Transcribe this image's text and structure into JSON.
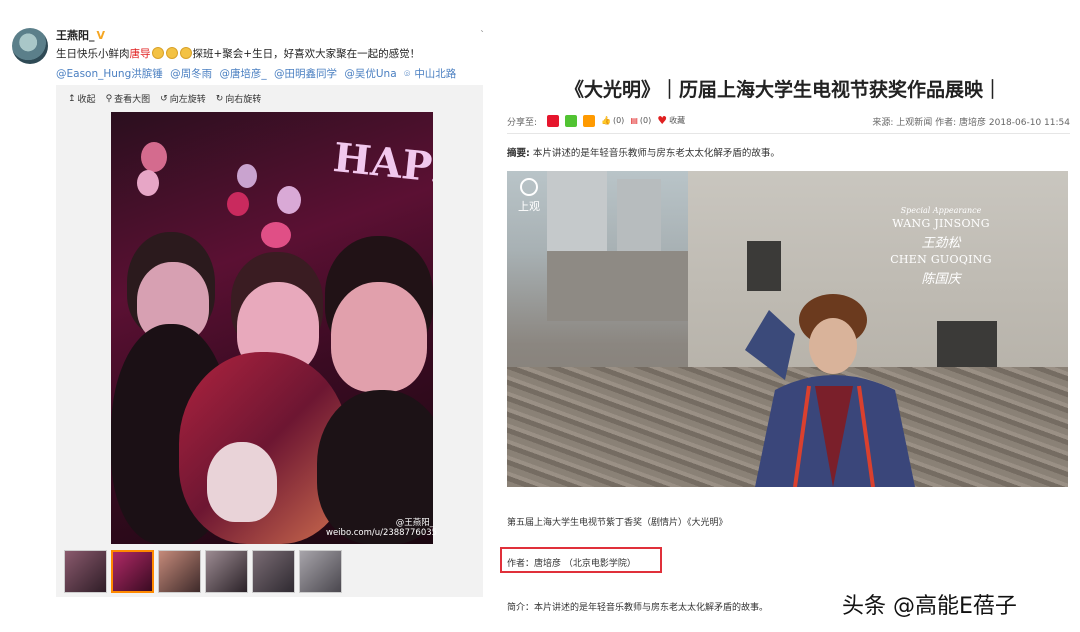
{
  "weibo": {
    "username": "王燕阳_",
    "verified_badge": "V",
    "post_text_before": "生日快乐小鲜肉",
    "post_text_red": "唐导",
    "post_text_after": "探班+聚会+生日，好喜欢大家聚在一起的感觉！",
    "mentions": [
      "@Eason_Hung洪膑锤",
      "@周冬雨",
      "@唐培彦_",
      "@田明鑫同学",
      "@吴优Una"
    ],
    "location": "中山北路",
    "toolbar": [
      "收起",
      "查看大图",
      "向左旋转",
      "向右旋转"
    ],
    "photo_balloon_text": "HAPPY",
    "watermark_name": "@王燕阳_",
    "watermark_url": "weibo.com/u/2388776035",
    "thumbnail_count": 6,
    "corner_mark": "ˋ"
  },
  "article": {
    "title": "《大光明》｜历届上海大学生电视节获奖作品展映｜",
    "share_label": "分享至:",
    "likes": "(0)",
    "comments": "(0)",
    "favorite_label": "收藏",
    "meta_right": "来源:  上观新闻   作者:  唐培彦   2018-06-10 11:54",
    "summary_label": "摘要:",
    "summary_text": "本片讲述的是年轻音乐教师与房东老太太化解矛盾的故事。",
    "still": {
      "logo_text": "上观",
      "special_appearance": "Special Appearance",
      "actor1": "WANG JINSONG",
      "actor1_sig": "王劲松",
      "actor2": "CHEN GUOQING",
      "actor2_sig": "陈国庆"
    },
    "caption": "第五届上海大学生电视节紫丁香奖（剧情片）《大光明》",
    "author_line": "作者：唐培彦 （北京电影学院）",
    "brief": "简介：本片讲述的是年轻音乐教师与房东老太太化解矛盾的故事。"
  },
  "credit_tag": "头条 @高能E蓓子"
}
